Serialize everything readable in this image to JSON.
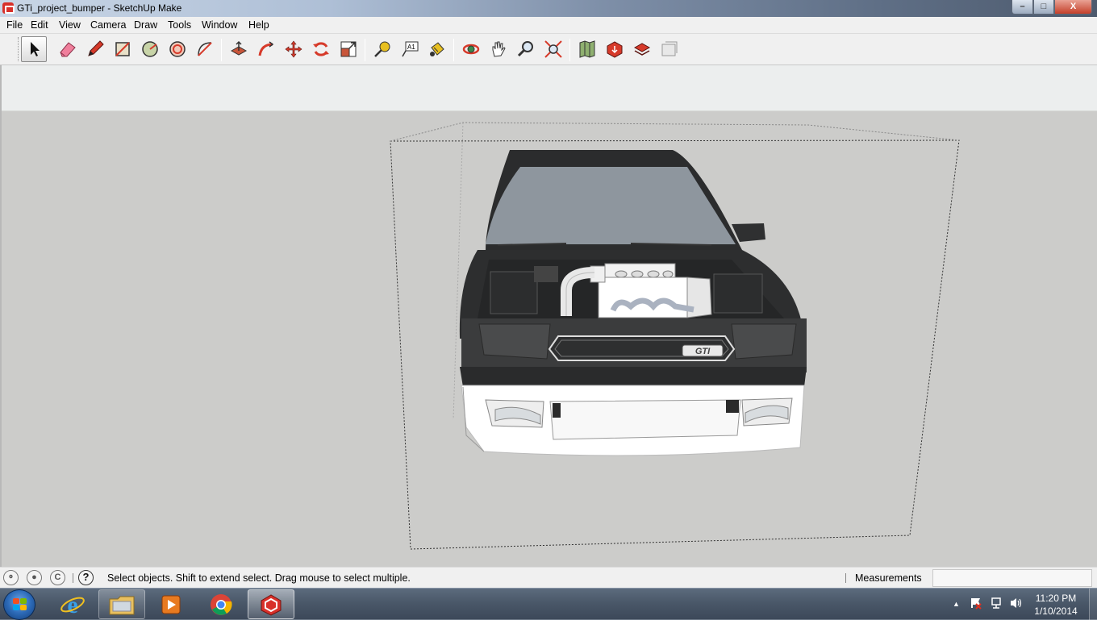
{
  "window": {
    "title": "GTi_project_bumper - SketchUp Make",
    "controls": {
      "minimize": "–",
      "maximize": "□",
      "close": "X"
    }
  },
  "menu": {
    "items": [
      "File",
      "Edit",
      "View",
      "Camera",
      "Draw",
      "Tools",
      "Window",
      "Help"
    ]
  },
  "toolbar": {
    "tools": [
      {
        "name": "select-tool",
        "active": true
      },
      {
        "name": "eraser-tool"
      },
      {
        "name": "line-tool"
      },
      {
        "name": "rectangle-tool"
      },
      {
        "name": "circle-tool"
      },
      {
        "name": "polygon-tool"
      },
      {
        "name": "arc-tool"
      },
      {
        "name": "push-pull-tool"
      },
      {
        "name": "follow-me-tool"
      },
      {
        "name": "move-tool"
      },
      {
        "name": "rotate-tool"
      },
      {
        "name": "scale-tool"
      },
      {
        "name": "tape-measure-tool"
      },
      {
        "name": "text-tool",
        "label": "A1"
      },
      {
        "name": "paint-bucket-tool"
      },
      {
        "name": "orbit-tool"
      },
      {
        "name": "pan-tool"
      },
      {
        "name": "zoom-tool"
      },
      {
        "name": "zoom-extents-tool"
      },
      {
        "name": "get-models-tool"
      },
      {
        "name": "share-model-tool"
      },
      {
        "name": "share-component-tool"
      },
      {
        "name": "extension-warehouse-tool"
      }
    ]
  },
  "scene": {
    "grille_badge": "GTI"
  },
  "status": {
    "geo_icons": [
      "geo-location-icon",
      "credits-icon",
      "copyright-icon"
    ],
    "help_glyph": "?",
    "message": "Select objects. Shift to extend select. Drag mouse to select multiple.",
    "measurements_label": "Measurements",
    "measurements_value": ""
  },
  "taskbar": {
    "pinned": [
      "internet-explorer",
      "windows-explorer",
      "media-player",
      "chrome",
      "sketchup"
    ],
    "active_app": "sketchup",
    "tray_arrow": "▲",
    "clock_time": "11:20 PM",
    "clock_date": "1/10/2014"
  },
  "colors": {
    "viewport_bg": "#ccccca",
    "car_body": "#3a3b3c",
    "bumper": "#ffffff",
    "windshield": "#8e969e",
    "title_accent": "#d8302a"
  }
}
